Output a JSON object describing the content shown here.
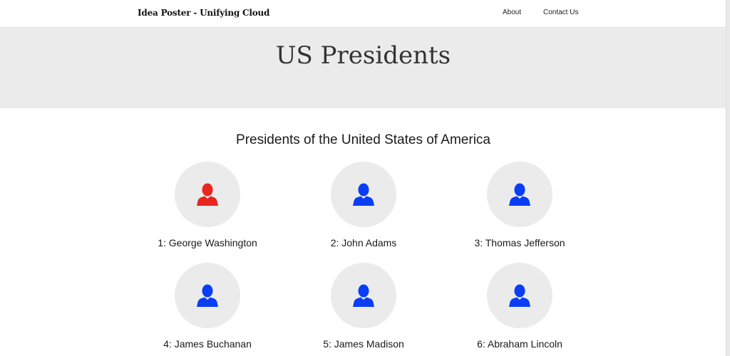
{
  "navbar": {
    "brand": "Idea Poster - Unifying Cloud",
    "links": [
      "About",
      "Contact Us"
    ]
  },
  "hero": {
    "title": "US Presidents"
  },
  "section": {
    "title": "Presidents of the United States of America"
  },
  "presidents": [
    {
      "label": "1: George Washington",
      "icon": "person-icon",
      "icon_color": "#e8251f"
    },
    {
      "label": "2: John Adams",
      "icon": "person-icon",
      "icon_color": "#0a3ef5"
    },
    {
      "label": "3: Thomas Jefferson",
      "icon": "person-icon",
      "icon_color": "#0a3ef5"
    },
    {
      "label": "4: James Buchanan",
      "icon": "person-icon",
      "icon_color": "#0a3ef5"
    },
    {
      "label": "5: James Madison",
      "icon": "person-icon",
      "icon_color": "#0a3ef5"
    },
    {
      "label": "6: Abraham Lincoln",
      "icon": "person-icon",
      "icon_color": "#0a3ef5"
    }
  ],
  "colors": {
    "hero_background": "#ebebeb",
    "avatar_background": "#ebebeb",
    "highlight_icon": "#e8251f",
    "default_icon": "#0a3ef5"
  }
}
